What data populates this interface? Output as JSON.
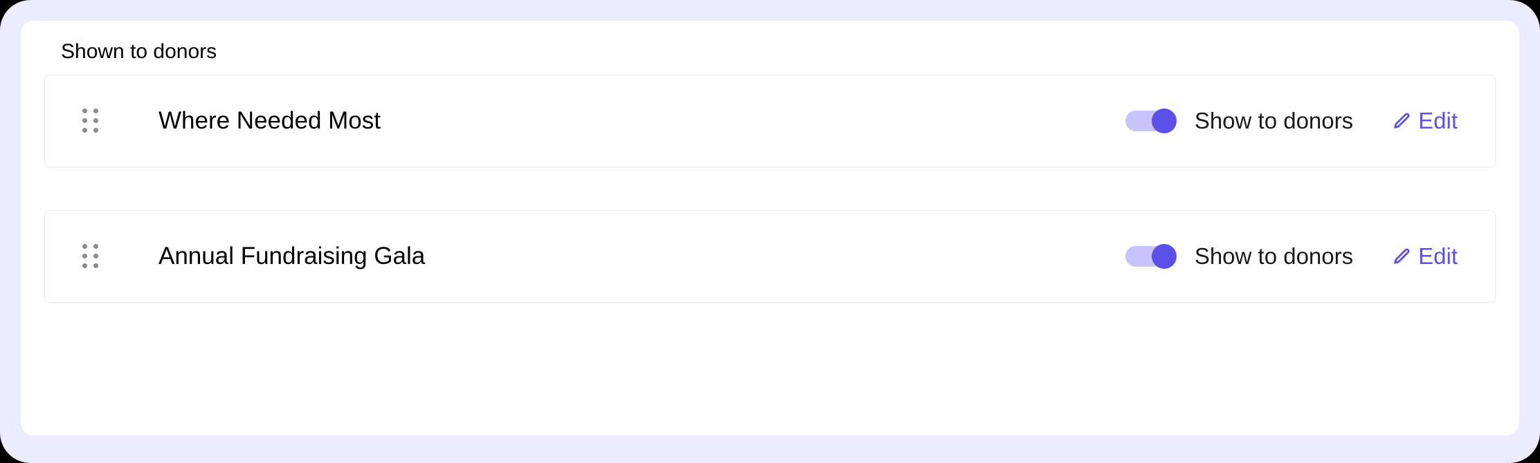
{
  "section": {
    "title": "Shown to donors"
  },
  "items": [
    {
      "title": "Where Needed Most",
      "toggle_label": "Show to donors",
      "toggle_on": true,
      "edit_label": "Edit"
    },
    {
      "title": "Annual Fundraising Gala",
      "toggle_label": "Show to donors",
      "toggle_on": true,
      "edit_label": "Edit"
    }
  ]
}
